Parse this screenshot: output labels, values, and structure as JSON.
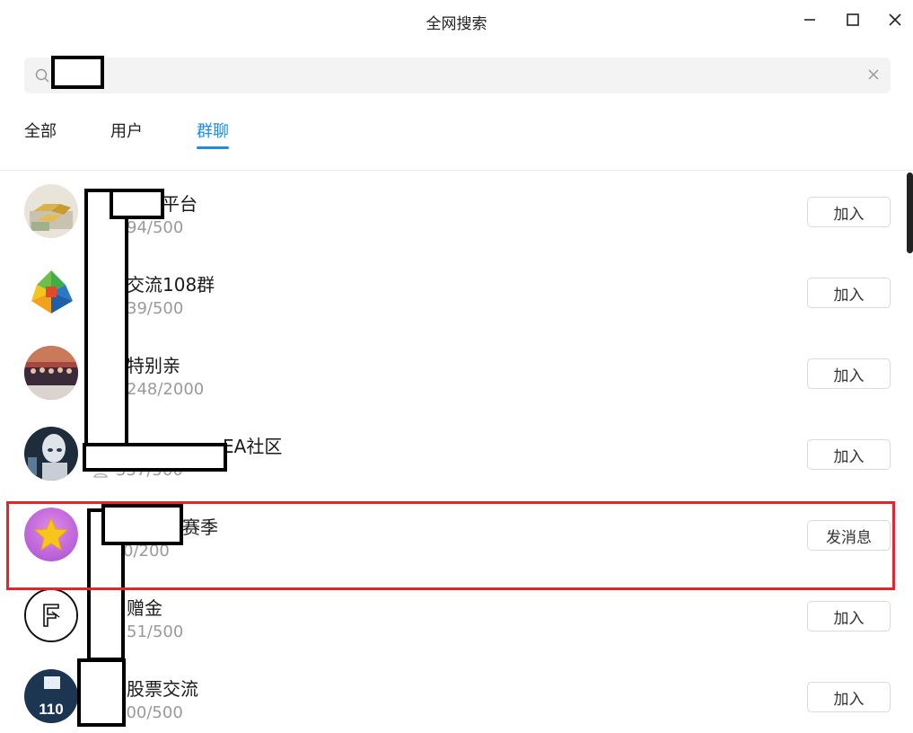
{
  "window": {
    "title": "全网搜索"
  },
  "search": {
    "value": "",
    "placeholder": ""
  },
  "tabs": [
    {
      "label": "全部",
      "active": false
    },
    {
      "label": "用户",
      "active": false
    },
    {
      "label": "群聊",
      "active": true
    }
  ],
  "groups": [
    {
      "name": "平台",
      "count": "94/500",
      "action": "加入",
      "avatar": "gold-bars-icon"
    },
    {
      "name": "交流108群",
      "count": "39/500",
      "action": "加入",
      "avatar": "metatrader-icon"
    },
    {
      "name": "特别亲",
      "count": "248/2000",
      "action": "加入",
      "avatar": "crowd-photo-icon"
    },
    {
      "name": "EA社区",
      "count": "357/500",
      "action": "加入",
      "avatar": "robot-icon"
    },
    {
      "name": "赛季",
      "count": "0/200",
      "action": "发消息",
      "avatar": "star-icon"
    },
    {
      "name": "赠金",
      "count": "51/500",
      "action": "加入",
      "avatar": "f-logo-icon"
    },
    {
      "name": "股票交流",
      "count": "300/500",
      "action": "加入",
      "avatar": "fx110-logo-icon"
    }
  ],
  "avatar_logo_text": {
    "fx110": "110"
  },
  "colors": {
    "accent": "#1f8ce0",
    "highlight": "#e3262c",
    "muted": "#9a9a9a"
  }
}
